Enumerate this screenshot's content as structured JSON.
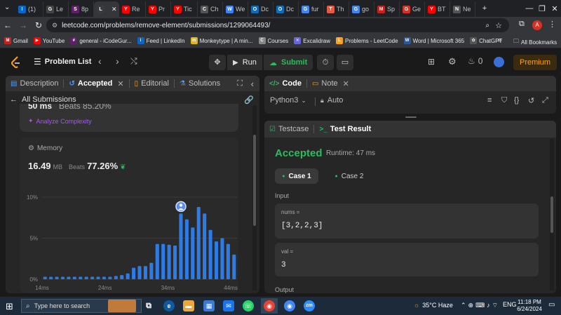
{
  "browser": {
    "tabs": [
      {
        "icon": "in",
        "color": "#0a66c2",
        "label": "(1)"
      },
      {
        "icon": "gh",
        "color": "#444",
        "label": "Le"
      },
      {
        "icon": "sl",
        "color": "#611f69",
        "label": "8p"
      },
      {
        "icon": "lc",
        "color": "#3a3a3a",
        "label": "",
        "active": true
      },
      {
        "icon": "yt",
        "color": "#ff0000",
        "label": "Re"
      },
      {
        "icon": "yt",
        "color": "#ff0000",
        "label": "Pr"
      },
      {
        "icon": "yt",
        "color": "#ff0000",
        "label": "Tic"
      },
      {
        "icon": "cg",
        "color": "#555",
        "label": "Ch"
      },
      {
        "icon": "we",
        "color": "#3b82f6",
        "label": "We"
      },
      {
        "icon": "od",
        "color": "#0f6cbd",
        "label": "Dc"
      },
      {
        "icon": "od",
        "color": "#0f6cbd",
        "label": "Dc"
      },
      {
        "icon": "g",
        "color": "#4285f4",
        "label": "fur"
      },
      {
        "icon": "th",
        "color": "#e05d44",
        "label": "Th"
      },
      {
        "icon": "g",
        "color": "#4285f4",
        "label": "go"
      },
      {
        "icon": "m",
        "color": "#c5221f",
        "label": "Sp"
      },
      {
        "icon": "ge",
        "color": "#d93025",
        "label": "Ge"
      },
      {
        "icon": "yt",
        "color": "#ff0000",
        "label": "BT"
      },
      {
        "icon": "ne",
        "color": "#555",
        "label": "Ne"
      }
    ],
    "url": "leetcode.com/problems/remove-element/submissions/1299064493/",
    "profile_initial": "A",
    "bookmarks": [
      {
        "icon": "M",
        "color": "#c5221f",
        "label": "Gmail"
      },
      {
        "icon": "▶",
        "color": "#ff0000",
        "label": "YouTube"
      },
      {
        "icon": "#",
        "color": "#611f69",
        "label": "general - iCodeGur..."
      },
      {
        "icon": "in",
        "color": "#0a66c2",
        "label": "Feed | LinkedIn"
      },
      {
        "icon": "mt",
        "color": "#e2b714",
        "label": "Monkeytype | A min..."
      },
      {
        "icon": "C",
        "color": "#888",
        "label": "Courses"
      },
      {
        "icon": "✕",
        "color": "#6965db",
        "label": "Excalidraw"
      },
      {
        "icon": "L",
        "color": "#ffa116",
        "label": "Problems - LeetCode"
      },
      {
        "icon": "W",
        "color": "#2b579a",
        "label": "Word | Microsoft 365"
      },
      {
        "icon": "✿",
        "color": "#555",
        "label": "ChatGPT"
      }
    ],
    "bookmarks_more": "»",
    "all_bookmarks": "All Bookmarks"
  },
  "leetcode": {
    "problem_list": "Problem List",
    "run": "Run",
    "submit": "Submit",
    "streak_count": "0",
    "premium": "Premium",
    "left_tabs": {
      "description": "Description",
      "accepted": "Accepted",
      "editorial": "Editorial",
      "solutions": "Solutions"
    },
    "all_submissions": "All Submissions",
    "runtime_partial": "50 ms",
    "runtime_beats_partial": "Beats 85.20%",
    "analyze": "Analyze Complexity",
    "memory_label": "Memory",
    "memory_value": "16.49",
    "memory_unit": "MB",
    "beats_label": "Beats",
    "memory_beats": "77.26%",
    "right_tabs": {
      "code": "Code",
      "note": "Note"
    },
    "language": "Python3",
    "auto": "Auto",
    "testcase_tab": "Testcase",
    "test_result_tab": "Test Result",
    "result_status": "Accepted",
    "result_runtime": "Runtime: 47 ms",
    "case1": "Case 1",
    "case2": "Case 2",
    "input_label": "Input",
    "nums_label": "nums =",
    "nums_value": "[3,2,2,3]",
    "val_label": "val =",
    "val_value": "3",
    "output_label": "Output"
  },
  "chart_data": {
    "type": "bar",
    "title": "",
    "xlabel": "",
    "ylabel": "",
    "ylim": [
      0,
      10
    ],
    "yticks": [
      "0%",
      "5%",
      "10%"
    ],
    "xticks": [
      "14ms",
      "24ms",
      "34ms",
      "44ms"
    ],
    "x_range_ms": [
      14,
      45
    ],
    "bar_color": "#2f7be5",
    "values": [
      0.3,
      0.3,
      0.3,
      0.3,
      0.3,
      0.3,
      0.3,
      0.3,
      0.3,
      0.3,
      0.3,
      0.3,
      0.4,
      0.5,
      0.7,
      1.4,
      1.6,
      1.6,
      2.0,
      4.3,
      4.3,
      4.2,
      4.1,
      8.0,
      7.3,
      6.3,
      8.8,
      8.0,
      6.0,
      4.6,
      5.0,
      4.3,
      3.0
    ],
    "highlight_index": 23
  },
  "taskbar": {
    "search_placeholder": "Type here to search",
    "weather": "35°C  Haze",
    "time": "11:18 PM",
    "date": "6/24/2024"
  }
}
